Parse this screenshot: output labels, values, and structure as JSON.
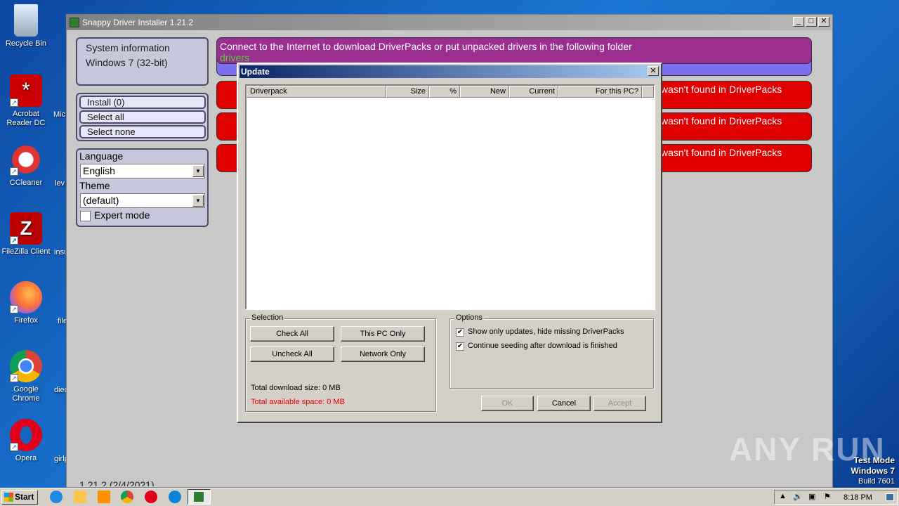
{
  "desktop": {
    "icons": [
      {
        "label": "Recycle Bin",
        "icon": "recycle-bin-icon"
      },
      {
        "label": "Acrobat Reader DC",
        "icon": "acrobat-icon"
      },
      {
        "label": "CCleaner",
        "icon": "ccleaner-icon"
      },
      {
        "label": "FileZilla Client",
        "icon": "filezilla-icon"
      },
      {
        "label": "Firefox",
        "icon": "firefox-icon"
      },
      {
        "label": "Google Chrome",
        "icon": "chrome-icon"
      },
      {
        "label": "Opera",
        "icon": "opera-icon"
      }
    ],
    "partial_labels": [
      "Mic",
      "lev",
      "insu",
      "file",
      "diec",
      "girlp"
    ]
  },
  "app": {
    "title": "Snappy Driver Installer 1.21.2",
    "version_footer": "1.21.2 (2/4/2021)",
    "sysinfo": {
      "line1": "System information",
      "line2": "Windows 7 (32-bit)"
    },
    "actions": {
      "install": "Install (0)",
      "select_all": "Select all",
      "select_none": "Select none"
    },
    "settings": {
      "language_label": "Language",
      "language_value": "English",
      "theme_label": "Theme",
      "theme_value": "(default)",
      "expert_mode": "Expert mode"
    },
    "messages": {
      "connect": "Connect to the Internet to download DriverPacks or put unpacked drivers in the following folder",
      "folder": "drivers",
      "not_found": "wasn't found in DriverPacks"
    }
  },
  "dialog": {
    "title": "Update",
    "columns": [
      "Driverpack",
      "Size",
      "%",
      "New",
      "Current",
      "For this PC?"
    ],
    "selection": {
      "label": "Selection",
      "check_all": "Check All",
      "this_pc_only": "This PC Only",
      "uncheck_all": "Uncheck All",
      "network_only": "Network Only",
      "total_download": "Total download size: 0 MB",
      "total_space": "Total available space: 0 MB"
    },
    "options": {
      "label": "Options",
      "opt1": "Show only updates, hide missing DriverPacks",
      "opt2": "Continue seeding after download is finished"
    },
    "buttons": {
      "ok": "OK",
      "cancel": "Cancel",
      "accept": "Accept"
    }
  },
  "taskbar": {
    "start": "Start",
    "clock": "8:18 PM"
  },
  "overlay": {
    "watermark": "ANY RUN",
    "test_mode": "Test Mode",
    "os": "Windows 7",
    "build": "Build 7601"
  },
  "colors": {
    "accent_purple": "#9b2f8f",
    "error_red": "#e00000",
    "title_blue": "#0a246a"
  }
}
